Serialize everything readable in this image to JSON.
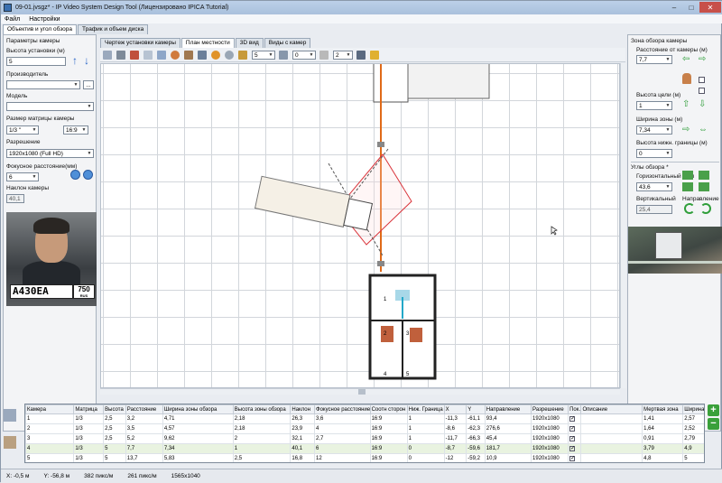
{
  "window": {
    "title": "09-01.jvsgz* - IP Video System Design Tool (Лицензировано  IPICA Tutorial)"
  },
  "menu": [
    "Файл",
    "Настройки"
  ],
  "top_tabs": [
    "Объектив и угол обзора",
    "Трафик и объем диска"
  ],
  "left": {
    "section_title": "Параметры камеры",
    "height_label": "Высота установки (м)",
    "height_value": "5",
    "manufacturer_label": "Производитель",
    "manufacturer_value": "",
    "browse_label": "...",
    "model_label": "Модель",
    "model_value": "",
    "matrix_label": "Размер матрицы камеры",
    "matrix_value": "1/3 \"",
    "aspect_value": "16:9",
    "resolution_label": "Разрешение",
    "resolution_value": "1920x1080 (Full HD)",
    "focal_label": "Фокусное расстояние(мм)",
    "focal_value": "6",
    "tilt_label": "Наклон камеры",
    "tilt_value": "40,1",
    "plate_text": "А430ЕА",
    "plate_region": "750",
    "plate_country": "RUS"
  },
  "view_tabs": [
    "Чертеж установки камеры",
    "План местности",
    "3D вид",
    "Виды с камер"
  ],
  "toolbar": {
    "line_width": "5",
    "angle": "0",
    "floor": "2"
  },
  "plan": {
    "room_labels": [
      "1",
      "2",
      "3",
      "4",
      "5"
    ]
  },
  "right": {
    "section_title": "Зона обзора камеры",
    "distance_label": "Расстояние от камеры (м)",
    "distance_value": "7,7",
    "target_height_label": "Высота цели (м)",
    "target_height_value": "1",
    "zone_width_label": "Ширина зоны (м)",
    "zone_width_value": "7,34",
    "lower_bound_label": "Высота нижн. границы (м)",
    "lower_bound_value": "0",
    "angles_title": "Углы обзора *",
    "hangle_label": "Горизонтальный угол",
    "hangle_value": "43,6",
    "vertical_label": "Вертикальный",
    "vertical_value": "25,4",
    "direction_label": "Направление"
  },
  "table": {
    "headers": [
      "Камера",
      "Матрица",
      "Высота ...",
      "Расстояние",
      "Ширина зоны обзора",
      "Высота зоны обзора",
      "Наклон",
      "Фокусное расстояние",
      "Соотн сторон",
      "Ниж. Граница",
      "X",
      "Y",
      "Направление",
      "Разрешение",
      "Пок...",
      "Описание",
      "Мертвая зона",
      "Ширина"
    ],
    "rows": [
      [
        "1",
        "1/3",
        "2,5",
        "3,2",
        "4,71",
        "2,18",
        "26,3",
        "3,6",
        "16:9",
        "1",
        "-11,3",
        "-61,1",
        "93,4",
        "1920x1080",
        "✓",
        "",
        "1,41",
        "2,57"
      ],
      [
        "2",
        "1/3",
        "2,5",
        "3,5",
        "4,57",
        "2,18",
        "23,9",
        "4",
        "16:9",
        "1",
        "-8,6",
        "-62,3",
        "276,6",
        "1920x1080",
        "✓",
        "",
        "1,64",
        "2,52"
      ],
      [
        "3",
        "1/3",
        "2,5",
        "5,2",
        "9,62",
        "2",
        "32,1",
        "2,7",
        "16:9",
        "1",
        "-11,7",
        "-66,3",
        "45,4",
        "1920x1080",
        "✓",
        "",
        "0,91",
        "2,79"
      ],
      [
        "4",
        "1/3",
        "5",
        "7,7",
        "7,34",
        "1",
        "40,1",
        "6",
        "16:9",
        "0",
        "-8,7",
        "-59,6",
        "181,7",
        "1920x1080",
        "✓",
        "",
        "3,79",
        "4,9"
      ],
      [
        "5",
        "1/3",
        "5",
        "13,7",
        "5,83",
        "2,5",
        "16,8",
        "12",
        "16:9",
        "0",
        "-12",
        "-59,2",
        "10,9",
        "1920x1080",
        "✓",
        "",
        "4,8",
        "5"
      ]
    ]
  },
  "status": {
    "x": "X: -0,5 м",
    "y": "Y: -56,8 м",
    "pix1": "382 пикс/м",
    "pix2": "261 пикс/м",
    "res": "1565x1040"
  }
}
